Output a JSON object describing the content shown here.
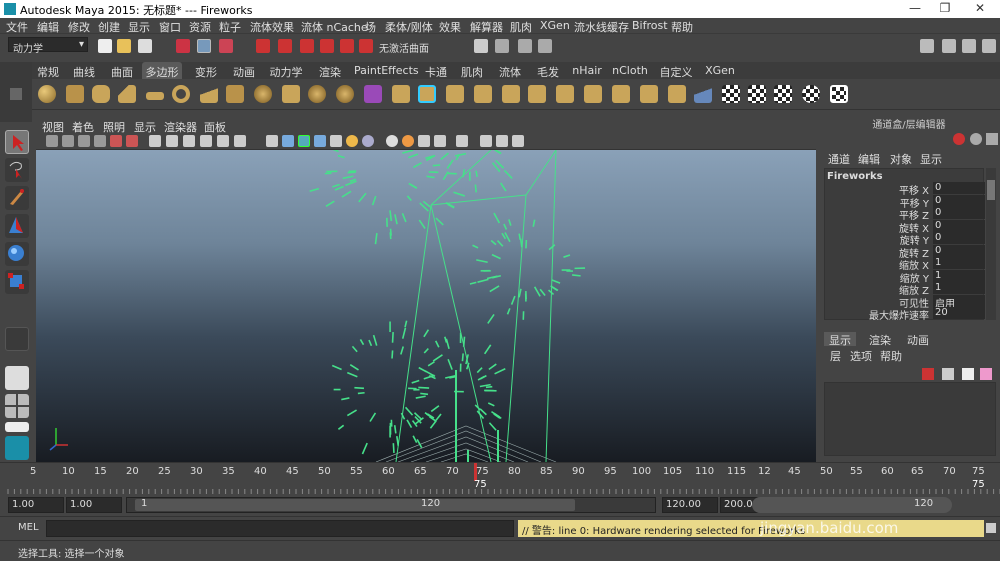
{
  "window": {
    "title": "Autodesk Maya 2015: 无标题*    ---    Fireworks"
  },
  "menu": [
    "文件",
    "编辑",
    "修改",
    "创建",
    "显示",
    "窗口",
    "资源",
    "粒子",
    "流体效果",
    "流体 nCache",
    "场",
    "柔体/刚体",
    "效果",
    "解算器",
    "肌肉",
    "XGen",
    "流水线缓存",
    "Bifrost",
    "帮助"
  ],
  "statusline": {
    "mode": "动力学",
    "curve_label": "无激活曲面"
  },
  "shelf": {
    "tabs": [
      "常规",
      "曲线",
      "曲面",
      "多边形",
      "变形",
      "动画",
      "动力学",
      "渲染",
      "PaintEffects",
      "卡通",
      "肌肉",
      "流体",
      "毛发",
      "nHair",
      "nCloth",
      "自定义",
      "XGen"
    ],
    "active_tab": "多边形"
  },
  "panel": {
    "menu": [
      "视图",
      "着色",
      "照明",
      "显示",
      "渲染器",
      "面板"
    ]
  },
  "channel_box": {
    "header": "通道盒/层编辑器",
    "menu": [
      "通道",
      "编辑",
      "对象",
      "显示"
    ],
    "object": "Fireworks",
    "attributes": [
      {
        "label": "平移 X",
        "value": "0"
      },
      {
        "label": "平移 Y",
        "value": "0"
      },
      {
        "label": "平移 Z",
        "value": "0"
      },
      {
        "label": "旋转 X",
        "value": "0"
      },
      {
        "label": "旋转 Y",
        "value": "0"
      },
      {
        "label": "旋转 Z",
        "value": "0"
      },
      {
        "label": "缩放 X",
        "value": "1"
      },
      {
        "label": "缩放 Y",
        "value": "1"
      },
      {
        "label": "缩放 Z",
        "value": "1"
      },
      {
        "label": "可见性",
        "value": "启用"
      },
      {
        "label": "最大爆炸速率",
        "value": "20"
      }
    ]
  },
  "layer_editor": {
    "tabs": [
      "显示",
      "渲染",
      "动画"
    ],
    "active_tab": "显示",
    "menu": [
      "层",
      "选项",
      "帮助"
    ]
  },
  "timeline": {
    "ticks_a": [
      "5",
      "10",
      "15",
      "20",
      "25",
      "30",
      "35",
      "40",
      "45",
      "50",
      "55",
      "60",
      "65",
      "70",
      "75",
      "80",
      "85",
      "90",
      "95",
      "100",
      "105",
      "110",
      "115",
      "12"
    ],
    "ticks_b": [
      "45",
      "50",
      "55",
      "60",
      "65",
      "70",
      "75"
    ],
    "current_frame": "75",
    "current_frame_right": "75"
  },
  "range": {
    "start": "1.00",
    "playback_start": "1.00",
    "slider_start": "1",
    "slider_end": "120",
    "playback_end": "120.00",
    "end": "200.00",
    "end_slider": "120"
  },
  "command": {
    "label": "MEL",
    "feedback": "// 警告: line 0: Hardware rendering selected for Fireworks",
    "watermark": "jingyan.baidu.com"
  },
  "help": {
    "text": "选择工具: 选择一个对象"
  },
  "colors": {
    "particle": "#46e08a",
    "panel_bg": "#444444",
    "feedback_bg": "#e9d98a"
  }
}
